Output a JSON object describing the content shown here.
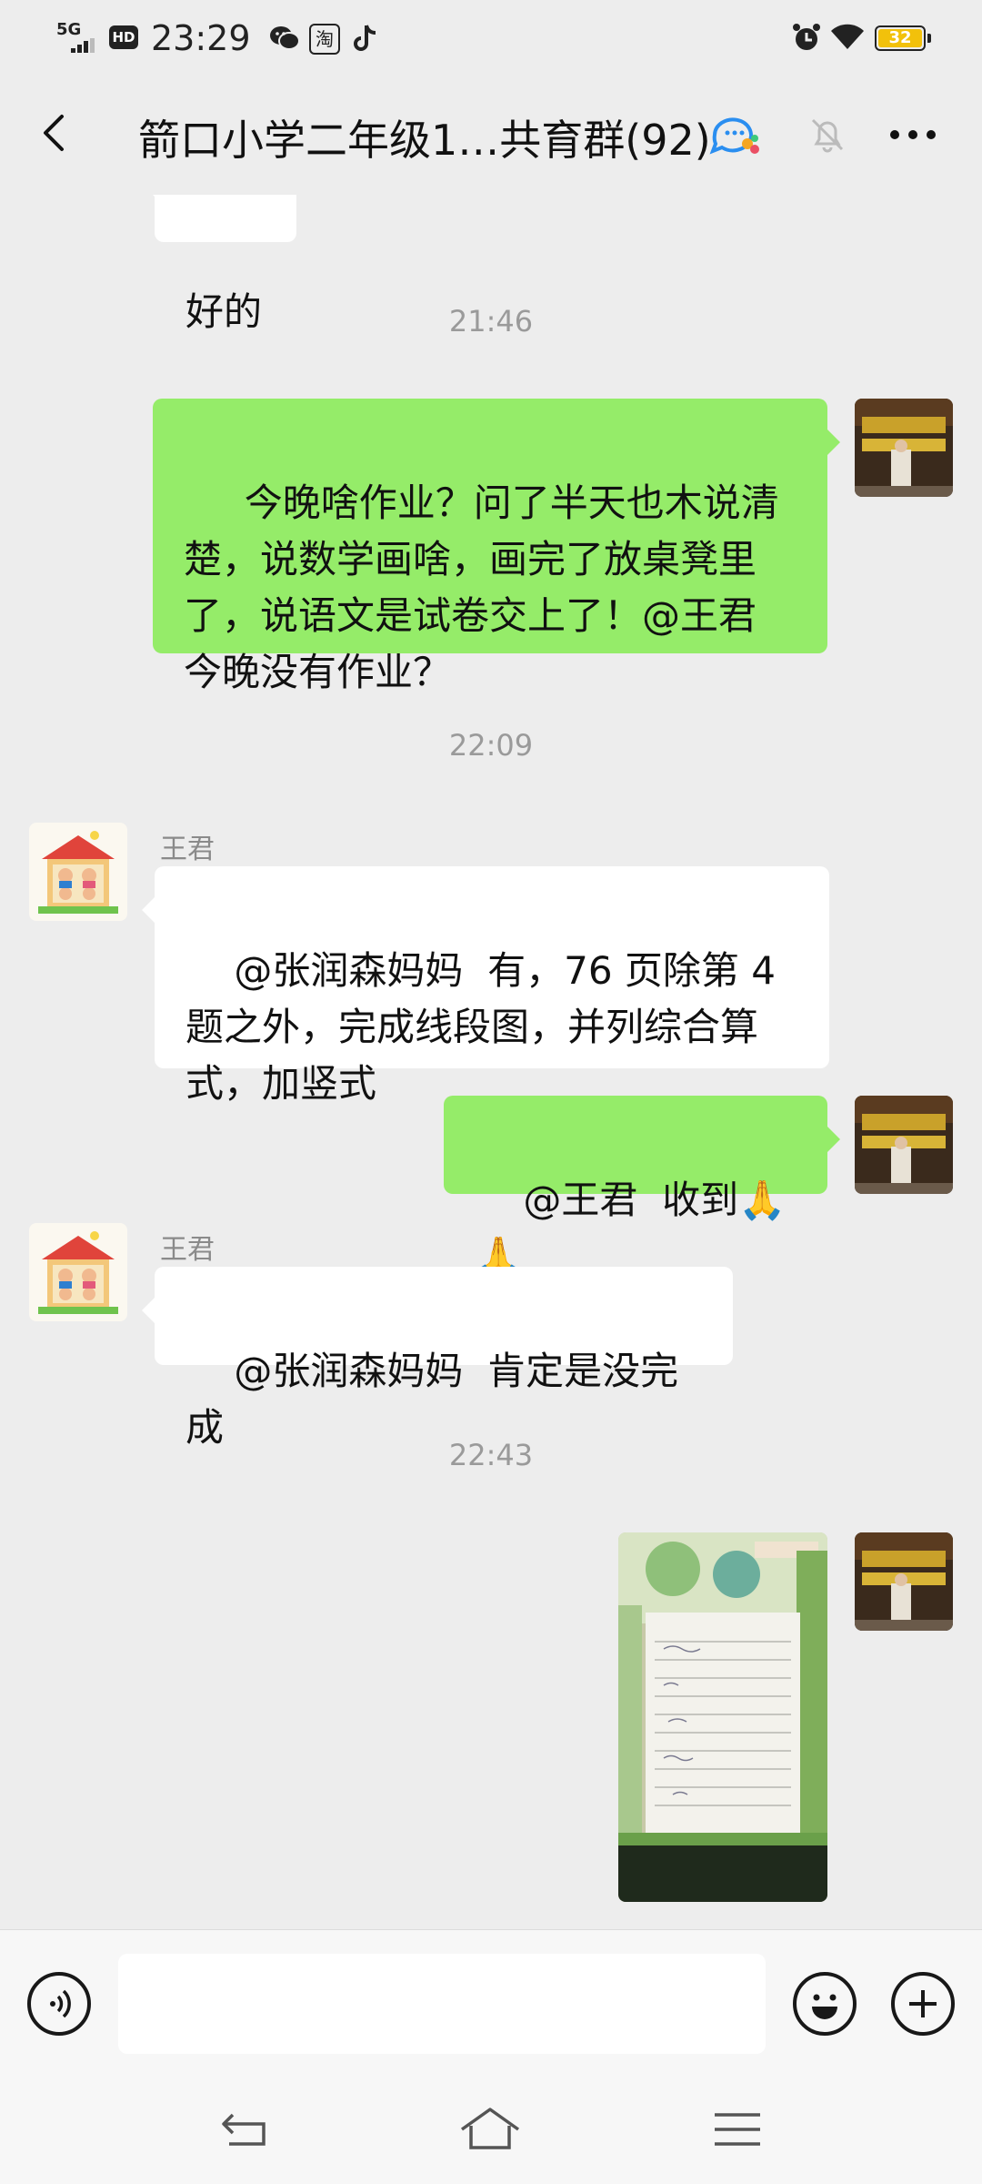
{
  "status_bar": {
    "network": "5G",
    "hd": "HD",
    "time": "23:29",
    "battery": "32",
    "apps": [
      "wechat-icon",
      "taobao-icon",
      "tiktok-icon"
    ],
    "taobao_glyph": "淘"
  },
  "header": {
    "title": "箭口小学二年级1…共育群(92)"
  },
  "chat": {
    "partial_bubble_text": "好的",
    "messages": [
      {
        "kind": "time",
        "text": "21:46"
      },
      {
        "kind": "text",
        "side": "right",
        "text": " 今晚啥作业？问了半天也木说清楚，说数学画啥，画完了放桌凳里了，说语文是试卷交上了！@王君  今晚没有作业？"
      },
      {
        "kind": "time",
        "text": "22:09"
      },
      {
        "kind": "text",
        "side": "left",
        "sender": "王君",
        "text": "@张润森妈妈  有，76 页除第 4 题之外，完成线段图，并列综合算式，加竖式"
      },
      {
        "kind": "text",
        "side": "right",
        "text": "@王君  收到🙏🙏"
      },
      {
        "kind": "text",
        "side": "left",
        "sender": "王君",
        "text": "@张润森妈妈  肯定是没完成"
      },
      {
        "kind": "time",
        "text": "22:43"
      },
      {
        "kind": "image",
        "side": "right"
      }
    ]
  },
  "input": {
    "placeholder": ""
  },
  "colors": {
    "background": "#ededed",
    "out_bubble": "#95ec69",
    "in_bubble": "#ffffff",
    "battery": "#f2c10b"
  }
}
